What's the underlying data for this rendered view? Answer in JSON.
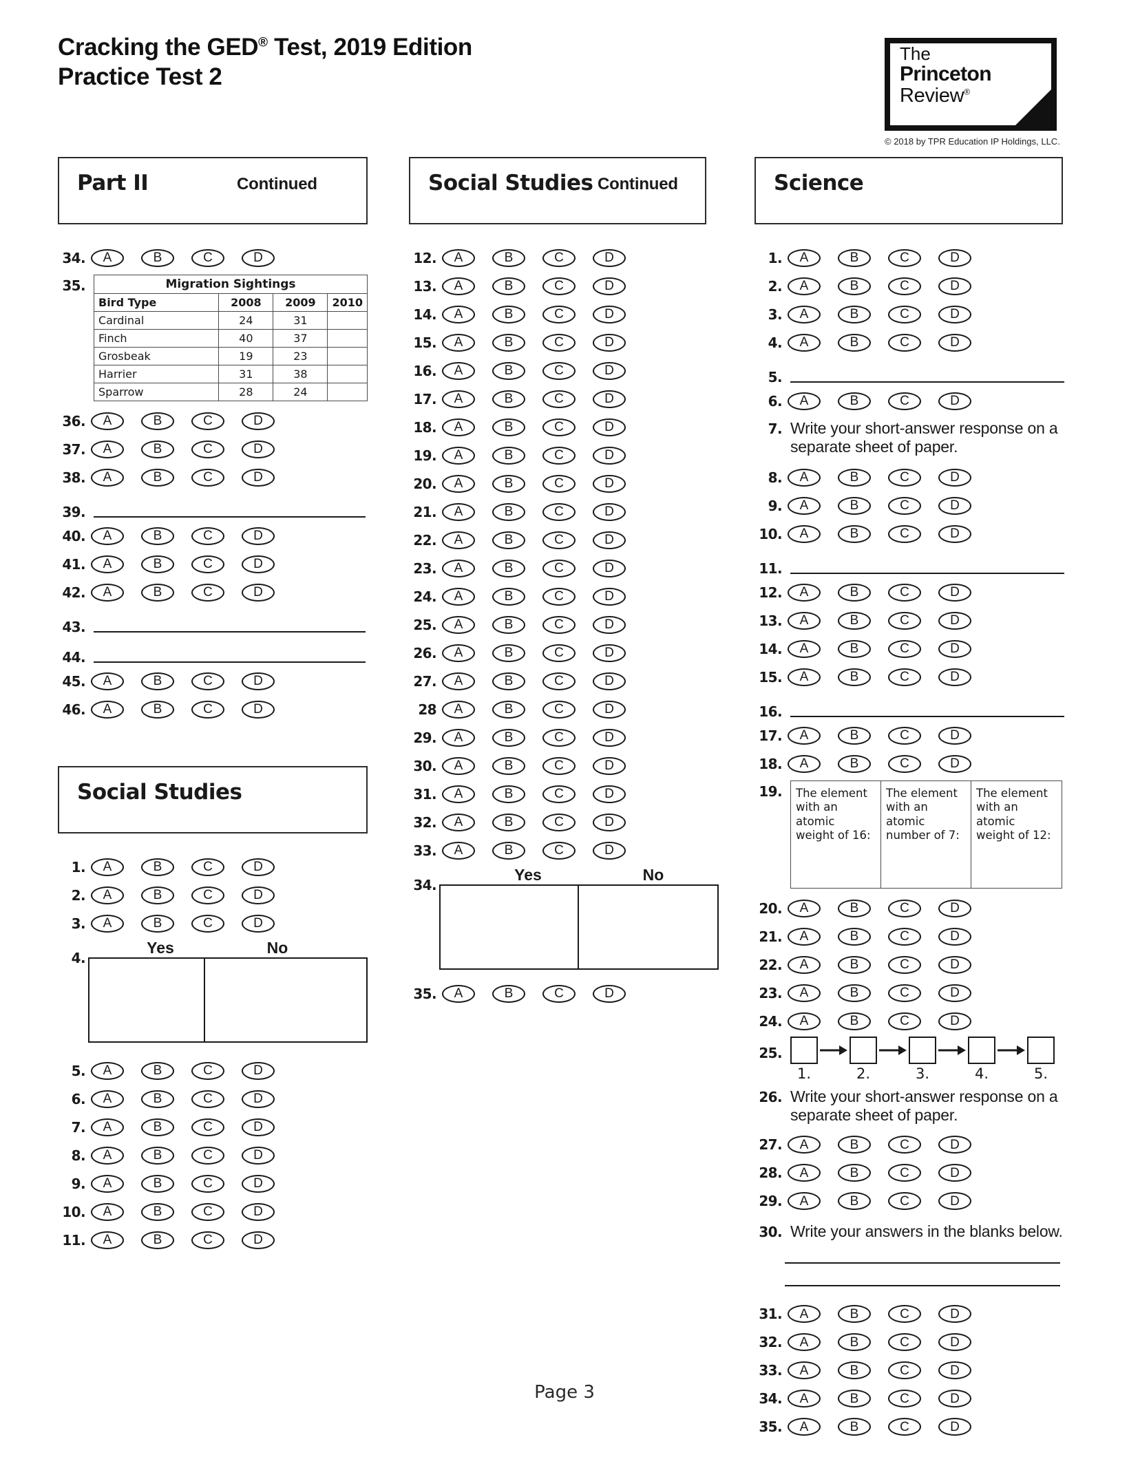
{
  "header": {
    "title_line1": "Cracking the GED",
    "title_reg": "®",
    "title_line1_tail": " Test, 2019 Edition",
    "title_line2": "Practice Test 2",
    "logo": {
      "line1": "The",
      "line2": "Princeton",
      "line3": "Review",
      "reg": "®"
    },
    "copyright": "© 2018 by TPR Education IP Holdings, LLC."
  },
  "choices": [
    "A",
    "B",
    "C",
    "D"
  ],
  "yes_no": {
    "yes": "Yes",
    "no": "No"
  },
  "columns": {
    "left": {
      "section_title": "Part II",
      "section_continued": "Continued",
      "q34": "34.",
      "q35": "35.",
      "table": {
        "caption": "Migration Sightings",
        "headers": [
          "Bird Type",
          "2008",
          "2009",
          "2010"
        ],
        "rows": [
          {
            "bird": "Cardinal",
            "y2008": "24",
            "y2009": "31",
            "y2010": ""
          },
          {
            "bird": "Finch",
            "y2008": "40",
            "y2009": "37",
            "y2010": ""
          },
          {
            "bird": "Grosbeak",
            "y2008": "19",
            "y2009": "23",
            "y2010": ""
          },
          {
            "bird": "Harrier",
            "y2008": "31",
            "y2009": "38",
            "y2010": ""
          },
          {
            "bird": "Sparrow",
            "y2008": "28",
            "y2009": "24",
            "y2010": ""
          }
        ]
      },
      "mc_36_38": [
        "36.",
        "37.",
        "38."
      ],
      "line_39": "39.",
      "mc_40_42": [
        "40.",
        "41.",
        "42."
      ],
      "line_43": "43.",
      "line_44": "44.",
      "mc_45_46": [
        "45.",
        "46."
      ],
      "social_title": "Social Studies",
      "ss_mc_1_3": [
        "1.",
        "2.",
        "3."
      ],
      "ss_q4": "4.",
      "ss_mc_5_11": [
        "5.",
        "6.",
        "7.",
        "8.",
        "9.",
        "10.",
        "11."
      ]
    },
    "middle": {
      "section_title": "Social Studies",
      "section_continued": "Continued",
      "mc_12_33": [
        "12.",
        "13.",
        "14.",
        "15.",
        "16.",
        "17.",
        "18.",
        "19.",
        "20.",
        "21.",
        "22.",
        "23.",
        "24.",
        "25.",
        "26.",
        "27.",
        "28",
        "29.",
        "30.",
        "31.",
        "32.",
        "33."
      ],
      "q34": "34.",
      "mc_35": "35."
    },
    "right": {
      "section_title": "Science",
      "mc_1_4": [
        "1.",
        "2.",
        "3.",
        "4."
      ],
      "line_5": "5.",
      "mc_6": "6.",
      "q7_num": "7.",
      "q7_text": "Write your short-answer response on a separate sheet of paper.",
      "mc_8_10": [
        "8.",
        "9.",
        "10."
      ],
      "line_11": "11.",
      "mc_12_15": [
        "12.",
        "13.",
        "14.",
        "15."
      ],
      "line_16": "16.",
      "mc_17_18": [
        "17.",
        "18."
      ],
      "q19_num": "19.",
      "q19_cells": [
        "The element with an atomic weight of 16:",
        "The element with an atomic number of 7:",
        "The element with an atomic weight of 12:"
      ],
      "mc_20_24": [
        "20.",
        "21.",
        "22.",
        "23.",
        "24."
      ],
      "q25_num": "25.",
      "q25_labels": [
        "1.",
        "2.",
        "3.",
        "4.",
        "5."
      ],
      "q26_num": "26.",
      "q26_text": "Write your short-answer response on a separate sheet of paper.",
      "mc_27_29": [
        "27.",
        "28.",
        "29."
      ],
      "q30_num": "30.",
      "q30_text": "Write your answers in the blanks below.",
      "mc_31_35": [
        "31.",
        "32.",
        "33.",
        "34.",
        "35."
      ]
    }
  },
  "footer": {
    "page_label": "Page 3"
  }
}
